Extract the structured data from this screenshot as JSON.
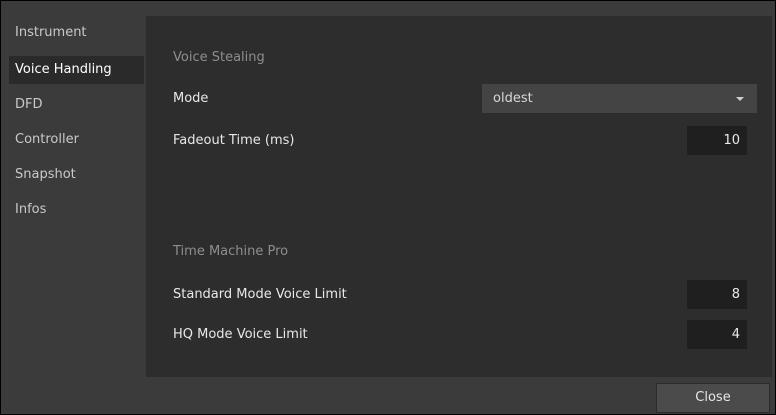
{
  "sidebar": {
    "items": [
      {
        "label": "Instrument",
        "active": false
      },
      {
        "label": "Voice Handling",
        "active": true
      },
      {
        "label": "DFD",
        "active": false
      },
      {
        "label": "Controller",
        "active": false
      },
      {
        "label": "Snapshot",
        "active": false
      },
      {
        "label": "Infos",
        "active": false
      }
    ]
  },
  "voice_stealing": {
    "title": "Voice Stealing",
    "mode_label": "Mode",
    "mode_value": "oldest",
    "fadeout_label": "Fadeout Time (ms)",
    "fadeout_value": "10"
  },
  "time_machine_pro": {
    "title": "Time Machine Pro",
    "standard_label": "Standard Mode Voice Limit",
    "standard_value": "8",
    "hq_label": "HQ Mode Voice Limit",
    "hq_value": "4"
  },
  "footer": {
    "close_label": "Close"
  },
  "colors": {
    "background": "#3b3b3b",
    "panel": "#2d2d2d",
    "field": "#1f1f1f",
    "select": "#444444",
    "active_item": "#2a2a2a",
    "section_title": "#8e8e8e"
  },
  "icons": {
    "dropdown": "chevron-down-icon"
  }
}
